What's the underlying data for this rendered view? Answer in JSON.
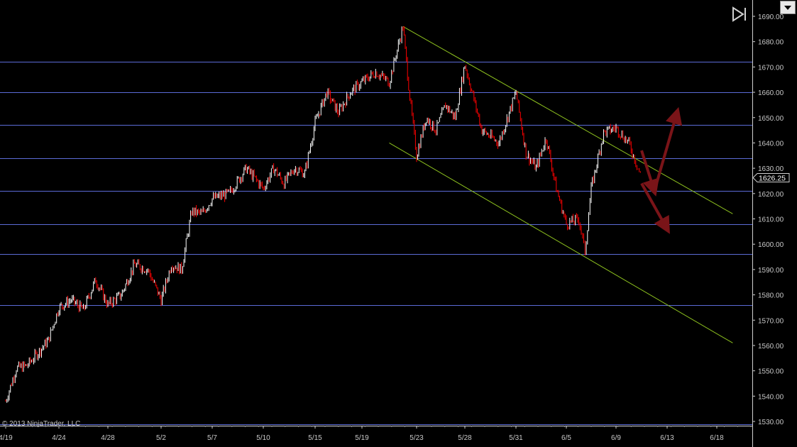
{
  "chart_data": {
    "type": "candlestick",
    "title": "",
    "xlabel": "",
    "ylabel": "",
    "ylim": [
      1528,
      1695
    ],
    "y_ticks": [
      1530,
      1540,
      1550,
      1560,
      1570,
      1580,
      1590,
      1600,
      1610,
      1620,
      1630,
      1640,
      1650,
      1660,
      1670,
      1680,
      1690
    ],
    "y_tick_labels": [
      "1530.00",
      "1540.00",
      "1550.00",
      "1560.00",
      "1570.00",
      "1580.00",
      "1590.00",
      "1600.00",
      "1610.00",
      "1620.00",
      "1630.00",
      "1640.00",
      "1650.00",
      "1660.00",
      "1670.00",
      "1680.00",
      "1690.00"
    ],
    "x_tick_labels": [
      "4/19",
      "4/24",
      "4/28",
      "5/2",
      "5/7",
      "5/10",
      "5/15",
      "5/19",
      "5/23",
      "5/28",
      "5/31",
      "6/5",
      "6/9",
      "6/13",
      "6/18"
    ],
    "price_path": [
      [
        "4/19",
        1538
      ],
      [
        "4/20",
        1551
      ],
      [
        "4/21",
        1552
      ],
      [
        "4/23",
        1562
      ],
      [
        "4/24",
        1575
      ],
      [
        "4/25",
        1578
      ],
      [
        "4/26",
        1574
      ],
      [
        "4/27",
        1586
      ],
      [
        "4/28",
        1576
      ],
      [
        "4/29",
        1580
      ],
      [
        "4/30",
        1592
      ],
      [
        "5/1",
        1590
      ],
      [
        "5/2",
        1578
      ],
      [
        "5/3",
        1592
      ],
      [
        "5/4",
        1590
      ],
      [
        "5/5",
        1613
      ],
      [
        "5/6",
        1612
      ],
      [
        "5/7",
        1618
      ],
      [
        "5/8",
        1620
      ],
      [
        "5/9",
        1630
      ],
      [
        "5/10",
        1622
      ],
      [
        "5/11",
        1630
      ],
      [
        "5/12",
        1624
      ],
      [
        "5/13",
        1630
      ],
      [
        "5/14",
        1628
      ],
      [
        "5/15",
        1648
      ],
      [
        "5/16",
        1660
      ],
      [
        "5/17",
        1652
      ],
      [
        "5/18",
        1660
      ],
      [
        "5/19",
        1664
      ],
      [
        "5/20",
        1668
      ],
      [
        "5/21",
        1664
      ],
      [
        "5/22",
        1686
      ],
      [
        "5/22b",
        1658
      ],
      [
        "5/23",
        1635
      ],
      [
        "5/24",
        1650
      ],
      [
        "5/25",
        1645
      ],
      [
        "5/26",
        1655
      ],
      [
        "5/27",
        1650
      ],
      [
        "5/28",
        1671
      ],
      [
        "5/29",
        1645
      ],
      [
        "5/30",
        1640
      ],
      [
        "5/31",
        1660
      ],
      [
        "6/1",
        1636
      ],
      [
        "6/2",
        1630
      ],
      [
        "6/3",
        1642
      ],
      [
        "6/4",
        1622
      ],
      [
        "6/5",
        1608
      ],
      [
        "6/6",
        1610
      ],
      [
        "6/6b",
        1597
      ],
      [
        "6/7",
        1622
      ],
      [
        "6/8",
        1644
      ],
      [
        "6/9",
        1646
      ],
      [
        "6/10",
        1640
      ],
      [
        "6/11",
        1626.25
      ]
    ],
    "last_price_label": "1626.25",
    "horizontal_levels": [
      1529,
      1576,
      1596,
      1608,
      1621,
      1634,
      1647,
      1660,
      1672
    ],
    "channel_lines": [
      {
        "from": [
          "5/22",
          1686
        ],
        "to": [
          "6/18+",
          1612
        ]
      },
      {
        "from": [
          "5/21",
          1640
        ],
        "to": [
          "6/18+",
          1561
        ]
      }
    ],
    "projection_arrows": [
      {
        "from": [
          "6/11",
          1637
        ],
        "to": [
          "6/12",
          1621
        ]
      },
      {
        "from": [
          "6/12",
          1621
        ],
        "to": [
          "6/14",
          1652
        ]
      },
      {
        "from": [
          "6/11",
          1624
        ],
        "to": [
          "6/13",
          1606
        ]
      }
    ],
    "colors": {
      "background": "#000000",
      "up_bar": "#ffffff",
      "down_bar": "#ff0000",
      "level_lines": "#5b6bd6",
      "channel": "#8fc31f",
      "arrows": "#7a1418",
      "axis_text": "#c8c8c8"
    },
    "grid": false
  },
  "watermark": "© 2013 NinjaTrader, LLC",
  "icons": {
    "nav": "skip-to-end-icon",
    "menu": "dropdown-arrow-icon"
  }
}
